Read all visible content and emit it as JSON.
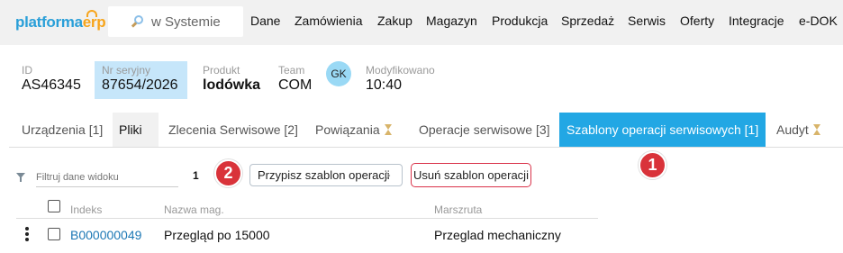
{
  "logo": {
    "part1": "platforma",
    "part2": "erp"
  },
  "search": {
    "label": "w Systemie",
    "icon": "search-icon"
  },
  "nav": [
    "Dane",
    "Zamówienia",
    "Zakup",
    "Magazyn",
    "Produkcja",
    "Sprzedaż",
    "Serwis",
    "Oferty",
    "Integracje",
    "e-DOK"
  ],
  "header": {
    "id_label": "ID",
    "id_value": "AS46345",
    "serial_label": "Nr seryjny",
    "serial_value": "87654/2026",
    "product_label": "Produkt",
    "product_value": "lodówka",
    "team_label": "Team",
    "team_value": "COM",
    "avatar": "GK",
    "modified_label": "Modyfikowano",
    "modified_value": "10:40"
  },
  "tabs": [
    "Urządzenia [1]",
    "Pliki",
    "Zlecenia Serwisowe [2]",
    "Powiązania",
    "Operacje serwisowe [3]",
    "Szablony operacji serwisowych [1]",
    "Audyt"
  ],
  "toolbar": {
    "filter_placeholder": "Filtruj dane widoku",
    "count": "1",
    "assign_label": "Przypisz szablon operacji",
    "remove_label": "Usuń szablon operacji"
  },
  "badges": {
    "one": "1",
    "two": "2"
  },
  "table": {
    "headers": [
      "Indeks",
      "Nazwa mag.",
      "Marszruta"
    ],
    "rows": [
      {
        "index": "B000000049",
        "name": "Przegląd po 15000",
        "route": "Przeglad mechaniczny"
      }
    ]
  },
  "colors": {
    "accent": "#22a7e4",
    "badge": "#d9333a",
    "logo_blue": "#2a9fd8",
    "logo_orange": "#f7a51c"
  }
}
